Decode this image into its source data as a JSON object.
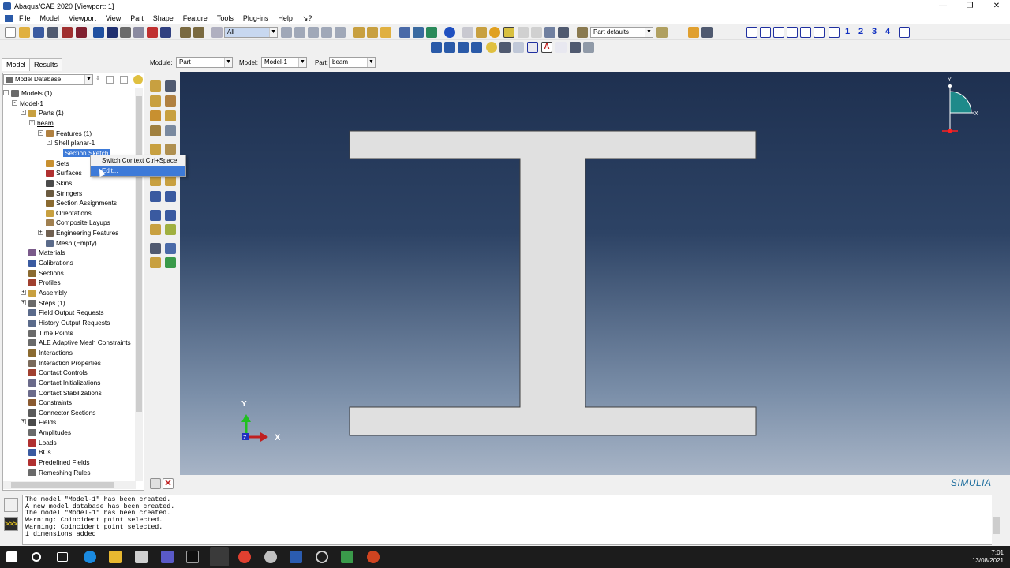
{
  "window": {
    "title": "Abaqus/CAE 2020 [Viewport: 1]"
  },
  "menu": [
    "File",
    "Model",
    "Viewport",
    "View",
    "Part",
    "Shape",
    "Feature",
    "Tools",
    "Plug-ins",
    "Help",
    "↘?"
  ],
  "toolbar": {
    "selection_filter": "All",
    "part_defaults": "Part defaults",
    "numbers": [
      "1",
      "2",
      "3",
      "4"
    ]
  },
  "context": {
    "module_label": "Module:",
    "module_value": "Part",
    "model_label": "Model:",
    "model_value": "Model-1",
    "part_label": "Part:",
    "part_value": "beam"
  },
  "tabs": [
    "Model",
    "Results"
  ],
  "tree": {
    "database": "Model Database",
    "items": [
      {
        "label": "Models (1)",
        "level": 0,
        "exp": "-",
        "icon": "#6a6a6a"
      },
      {
        "label": "Model-1",
        "level": 1,
        "exp": "-",
        "icon": "",
        "underline": true
      },
      {
        "label": "Parts (1)",
        "level": 2,
        "exp": "-",
        "icon": "#c8a040"
      },
      {
        "label": "beam",
        "level": 3,
        "exp": "-",
        "icon": "",
        "underline": true
      },
      {
        "label": "Features (1)",
        "level": 4,
        "exp": "-",
        "icon": "#b08040"
      },
      {
        "label": "Shell planar-1",
        "level": 5,
        "exp": "-",
        "icon": ""
      },
      {
        "label": "Section Sketch",
        "level": 6,
        "exp": "",
        "icon": "",
        "selected": true
      },
      {
        "label": "Sets",
        "level": 4,
        "exp": "",
        "icon": "#c89030"
      },
      {
        "label": "Surfaces",
        "level": 4,
        "exp": "",
        "icon": "#b03030"
      },
      {
        "label": "Skins",
        "level": 4,
        "exp": "",
        "icon": "#4a4a4a"
      },
      {
        "label": "Stringers",
        "level": 4,
        "exp": "",
        "icon": "#6a5a40"
      },
      {
        "label": "Section Assignments",
        "level": 4,
        "exp": "",
        "icon": "#8a6a30"
      },
      {
        "label": "Orientations",
        "level": 4,
        "exp": "",
        "icon": "#c8a040"
      },
      {
        "label": "Composite Layups",
        "level": 4,
        "exp": "",
        "icon": "#a08050"
      },
      {
        "label": "Engineering Features",
        "level": 4,
        "exp": "+",
        "icon": "#706050"
      },
      {
        "label": "Mesh (Empty)",
        "level": 4,
        "exp": "",
        "icon": "#5a6a8a"
      },
      {
        "label": "Materials",
        "level": 2,
        "exp": "",
        "icon": "#7a5a8a"
      },
      {
        "label": "Calibrations",
        "level": 2,
        "exp": "",
        "icon": "#3a5aa0"
      },
      {
        "label": "Sections",
        "level": 2,
        "exp": "",
        "icon": "#8a6a30"
      },
      {
        "label": "Profiles",
        "level": 2,
        "exp": "",
        "icon": "#a04030"
      },
      {
        "label": "Assembly",
        "level": 2,
        "exp": "+",
        "icon": "#c8a040"
      },
      {
        "label": "Steps (1)",
        "level": 2,
        "exp": "+",
        "icon": "#6a6a6a"
      },
      {
        "label": "Field Output Requests",
        "level": 2,
        "exp": "",
        "icon": "#5a6a8a"
      },
      {
        "label": "History Output Requests",
        "level": 2,
        "exp": "",
        "icon": "#5a6a8a"
      },
      {
        "label": "Time Points",
        "level": 2,
        "exp": "",
        "icon": "#6a6a6a"
      },
      {
        "label": "ALE Adaptive Mesh Constraints",
        "level": 2,
        "exp": "",
        "icon": "#6a6a6a"
      },
      {
        "label": "Interactions",
        "level": 2,
        "exp": "",
        "icon": "#8a6a30"
      },
      {
        "label": "Interaction Properties",
        "level": 2,
        "exp": "",
        "icon": "#7a6a5a"
      },
      {
        "label": "Contact Controls",
        "level": 2,
        "exp": "",
        "icon": "#a04030"
      },
      {
        "label": "Contact Initializations",
        "level": 2,
        "exp": "",
        "icon": "#6a6a8a"
      },
      {
        "label": "Contact Stabilizations",
        "level": 2,
        "exp": "",
        "icon": "#6a6a8a"
      },
      {
        "label": "Constraints",
        "level": 2,
        "exp": "",
        "icon": "#8a5a30"
      },
      {
        "label": "Connector Sections",
        "level": 2,
        "exp": "",
        "icon": "#5a5a5a"
      },
      {
        "label": "Fields",
        "level": 2,
        "exp": "+",
        "icon": "#4a4a4a"
      },
      {
        "label": "Amplitudes",
        "level": 2,
        "exp": "",
        "icon": "#6a6a6a"
      },
      {
        "label": "Loads",
        "level": 2,
        "exp": "",
        "icon": "#b03030"
      },
      {
        "label": "BCs",
        "level": 2,
        "exp": "",
        "icon": "#3a5aa0"
      },
      {
        "label": "Predefined Fields",
        "level": 2,
        "exp": "",
        "icon": "#b03030"
      },
      {
        "label": "Remeshing Rules",
        "level": 2,
        "exp": "",
        "icon": "#6a6a6a"
      }
    ]
  },
  "context_menu": {
    "items": [
      {
        "label": "Switch Context  Ctrl+Space"
      },
      {
        "label": "Edit..."
      }
    ]
  },
  "viewport": {
    "triad_y": "Y",
    "triad_x": "X",
    "triad_z": "Z",
    "mini_y": "Y",
    "mini_x": "X"
  },
  "brand": "SIMULIA",
  "messages": [
    "The model \"Model-1\" has been created.",
    "A new model database has been created.",
    "The model \"Model-1\" has been created.",
    "Warning: Coincident point selected.",
    "Warning: Coincident point selected.",
    "1 dimensions added"
  ],
  "clock": {
    "time": "7:01",
    "date": "13/08/2021"
  },
  "colors": {
    "viewport_top": "#1e3050",
    "viewport_bottom": "#a7b4c6",
    "selection": "#3d7ad8",
    "taskbar": "#1c1c1c"
  }
}
